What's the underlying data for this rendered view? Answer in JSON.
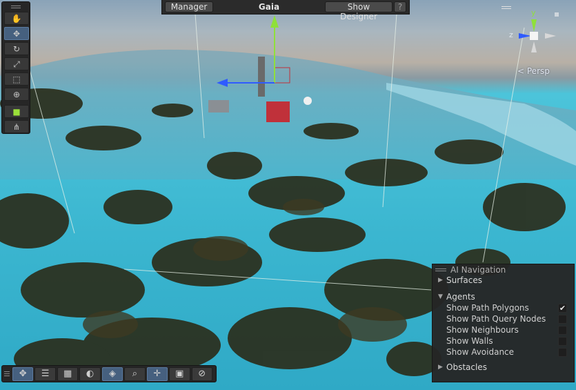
{
  "overlay": {
    "manager_label": "Manager",
    "scene_title": "Gaia",
    "show_designer_label": "Show Designer",
    "help_label": "?"
  },
  "tools": [
    {
      "icon": "hand-icon",
      "glyph": "✋",
      "active": false
    },
    {
      "icon": "move-icon",
      "glyph": "✥",
      "active": true
    },
    {
      "icon": "rotate-icon",
      "glyph": "↻",
      "active": false
    },
    {
      "icon": "scale-icon",
      "glyph": "⤢",
      "active": false
    },
    {
      "icon": "rect-icon",
      "glyph": "⬚",
      "active": false
    },
    {
      "icon": "transform-icon",
      "glyph": "⊕",
      "active": false
    },
    {
      "icon": "gaia-cube-icon",
      "glyph": "■",
      "active": false
    },
    {
      "icon": "node-icon",
      "glyph": "⋔",
      "active": false
    }
  ],
  "gizmo": {
    "persp_label": "Persp",
    "y_label": "y",
    "z_label": "z"
  },
  "bottom_tools": [
    {
      "icon": "move-icon",
      "glyph": "✥",
      "active": true
    },
    {
      "icon": "sliders-icon",
      "glyph": "☰",
      "active": false
    },
    {
      "icon": "grid-icon",
      "glyph": "▦",
      "active": false
    },
    {
      "icon": "moon-icon",
      "glyph": "◐",
      "active": false
    },
    {
      "icon": "layers-icon",
      "glyph": "◈",
      "active": true
    },
    {
      "icon": "search-icon",
      "glyph": "⌕",
      "active": false
    },
    {
      "icon": "snap-icon",
      "glyph": "✛",
      "active": true
    },
    {
      "icon": "camera-icon",
      "glyph": "▣",
      "active": false
    },
    {
      "icon": "compass-icon",
      "glyph": "⊘",
      "active": false
    }
  ],
  "ai_navigation": {
    "title": "AI Navigation",
    "surfaces_label": "Surfaces",
    "agents_label": "Agents",
    "options": [
      {
        "label": "Show Path Polygons",
        "checked": true
      },
      {
        "label": "Show Path Query Nodes",
        "checked": false
      },
      {
        "label": "Show Neighbours",
        "checked": false
      },
      {
        "label": "Show Walls",
        "checked": false
      },
      {
        "label": "Show Avoidance",
        "checked": false
      }
    ],
    "obstacles_label": "Obstacles"
  },
  "colors": {
    "navmesh": "#3bb6d0",
    "active_tool": "#46607f",
    "gizmo_y": "#8fe03a",
    "gizmo_x": "#2f5bff",
    "selection_box": "#c0313a"
  }
}
